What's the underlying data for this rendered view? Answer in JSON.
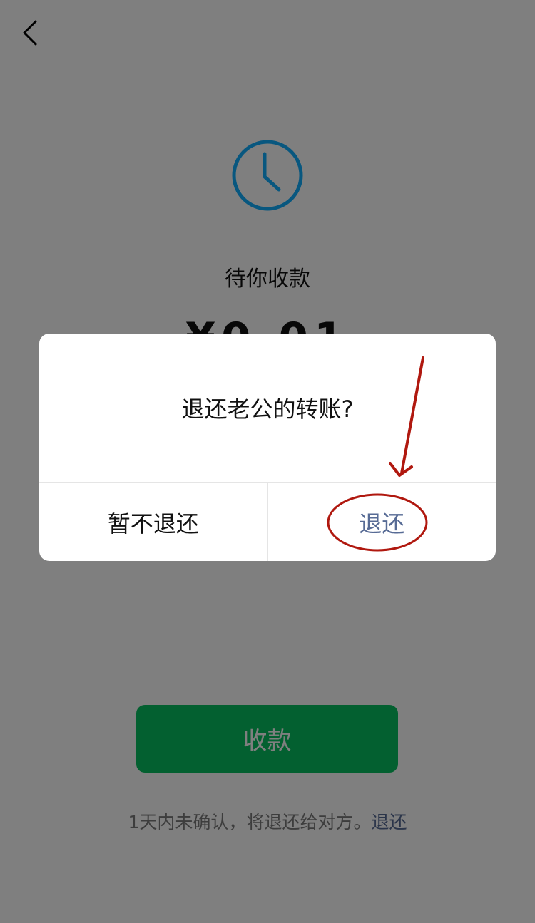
{
  "background_page": {
    "status_text": "待你收款",
    "amount": "¥0.01",
    "receive_button": "收款",
    "footer_note": "1天内未确认，将退还给对方。",
    "footer_link": "退还",
    "icons": {
      "back": "chevron-left-icon",
      "status": "clock-icon"
    }
  },
  "dialog": {
    "title": "退还老公的转账?",
    "cancel_label": "暂不退还",
    "confirm_label": "退还"
  },
  "colors": {
    "overlay": "rgba(0,0,0,0.5)",
    "accent_green": "#07c160",
    "link_blue": "#576b95",
    "clock_blue": "#10aeff",
    "annotation_red": "#b0180f"
  }
}
